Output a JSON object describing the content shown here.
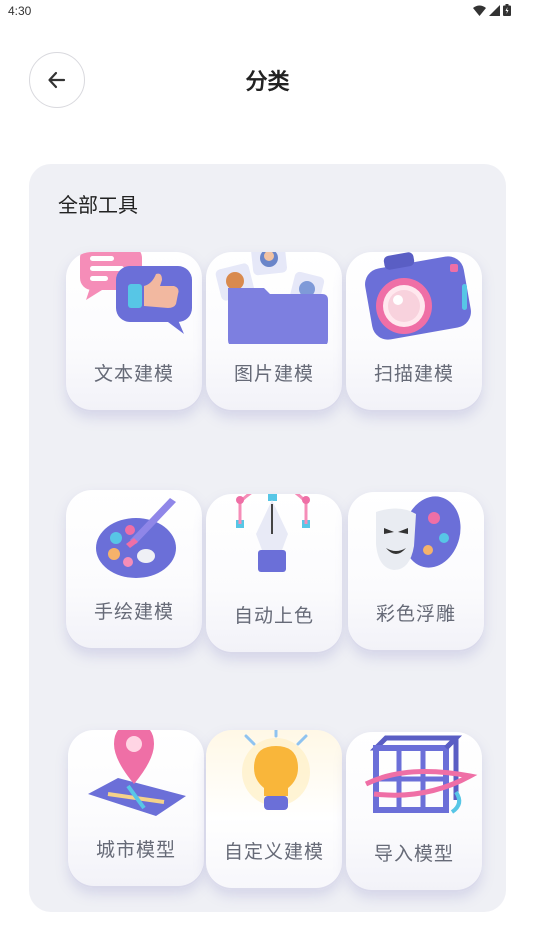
{
  "status_bar": {
    "time": "4:30"
  },
  "header": {
    "title": "分类"
  },
  "section": {
    "title": "全部工具",
    "tools": [
      {
        "label": "文本建模",
        "icon": "chat-bubbles-icon"
      },
      {
        "label": "图片建模",
        "icon": "photo-folder-icon"
      },
      {
        "label": "扫描建模",
        "icon": "camera-icon"
      },
      {
        "label": "手绘建模",
        "icon": "paint-palette-icon"
      },
      {
        "label": "自动上色",
        "icon": "pen-tool-icon"
      },
      {
        "label": "彩色浮雕",
        "icon": "theater-mask-icon"
      },
      {
        "label": "城市模型",
        "icon": "map-pin-icon"
      },
      {
        "label": "自定义建模",
        "icon": "lightbulb-icon"
      },
      {
        "label": "导入模型",
        "icon": "wireframe-cube-icon"
      }
    ]
  },
  "colors": {
    "panel": "#eff0f5",
    "accent": "#6b6fd8",
    "pink": "#ef6fa6"
  }
}
